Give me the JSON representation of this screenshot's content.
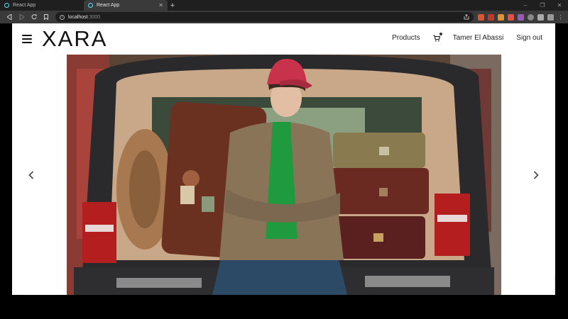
{
  "browser": {
    "tabs": [
      {
        "title": "React App",
        "active": false
      },
      {
        "title": "React App",
        "active": true
      }
    ],
    "new_tab": "+",
    "window_controls": [
      "–",
      "❐",
      "✕"
    ],
    "url_host": "localhost",
    "url_port": ":3000",
    "extension_colors": [
      "#e0522f",
      "#c0392b",
      "#e0922f",
      "#e74c3c",
      "#9b59b6",
      "#aaaaaa",
      "#bbbbbb",
      "#cccccc"
    ]
  },
  "header": {
    "logo": "XARA",
    "nav": {
      "products": "Products",
      "user": "Tamer El Abassi",
      "sign_out": "Sign out"
    }
  },
  "carousel": {
    "prev_icon": "chevron-left-icon",
    "next_icon": "chevron-right-icon",
    "slide_alt": "model sitting in car trunk with suitcases"
  },
  "colors": {
    "accent_cap": "#c8324a",
    "blazer": "#8a7458",
    "sweater": "#1f9a3e",
    "jeans": "#2c4a66"
  }
}
